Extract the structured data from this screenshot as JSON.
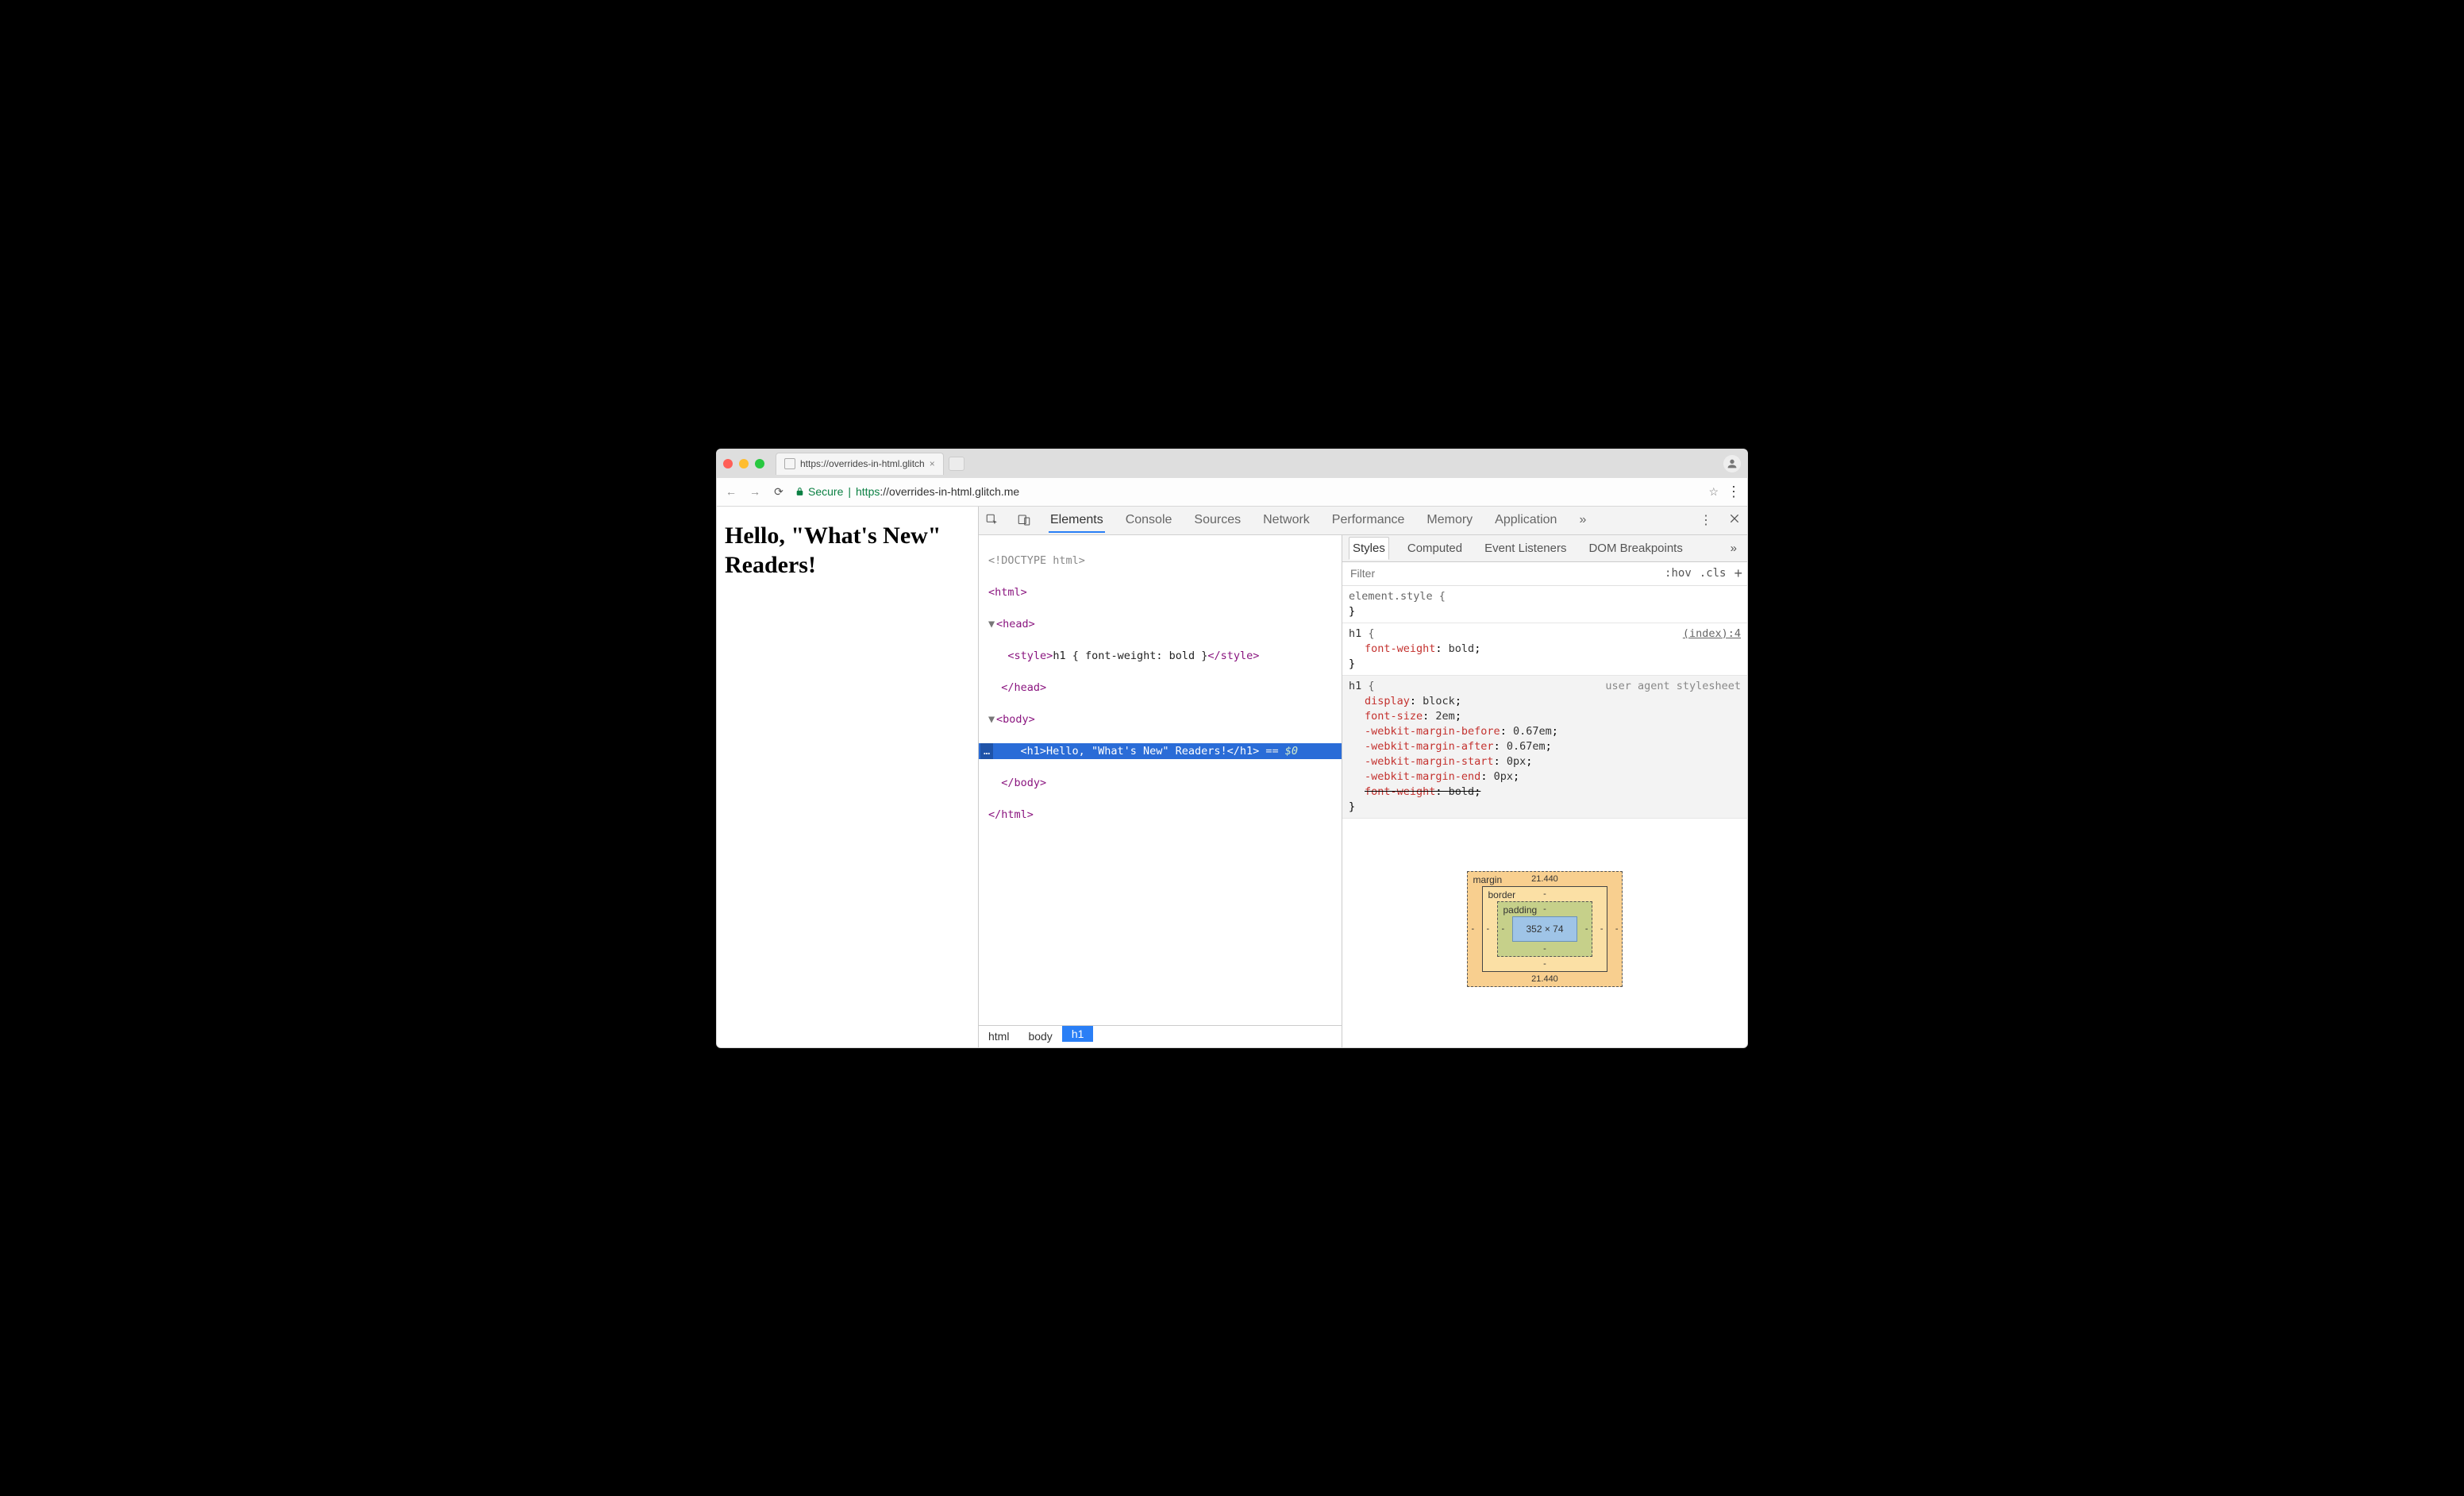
{
  "tab": {
    "title": "https://overrides-in-html.glitch"
  },
  "omnibox": {
    "secure_label": "Secure",
    "proto": "https",
    "url_rest": "://overrides-in-html.glitch.me"
  },
  "page": {
    "h1": "Hello, \"What's New\" Readers!"
  },
  "devtools": {
    "tabs": [
      "Elements",
      "Console",
      "Sources",
      "Network",
      "Performance",
      "Memory",
      "Application"
    ],
    "more": "»"
  },
  "dom": {
    "doctype": "<!DOCTYPE html>",
    "html_open": "<html>",
    "head_open": "<head>",
    "style_line_open": "<style>",
    "style_css": "h1 { font-weight: bold }",
    "style_line_close": "</style>",
    "head_close": "</head>",
    "body_open": "<body>",
    "selected": {
      "ellipsis": "…",
      "open": "<h1>",
      "text": "Hello, \"What's New\" Readers!",
      "close": "</h1>",
      "eq": " == ",
      "ref": "$0"
    },
    "body_close": "</body>",
    "html_close": "</html>"
  },
  "breadcrumb": [
    "html",
    "body",
    "h1"
  ],
  "styles_panel": {
    "tabs": [
      "Styles",
      "Computed",
      "Event Listeners",
      "DOM Breakpoints"
    ],
    "more": "»",
    "filter_placeholder": "Filter",
    "hov": ":hov",
    "cls": ".cls",
    "rules": [
      {
        "selector": "element.style",
        "src": "",
        "decls": []
      },
      {
        "selector": "h1",
        "src": "(index):4",
        "src_link": true,
        "decls": [
          {
            "prop": "font-weight",
            "val": "bold",
            "ovr": false
          }
        ]
      },
      {
        "selector": "h1",
        "src": "user agent stylesheet",
        "ua": true,
        "decls": [
          {
            "prop": "display",
            "val": "block",
            "ovr": false
          },
          {
            "prop": "font-size",
            "val": "2em",
            "ovr": false
          },
          {
            "prop": "-webkit-margin-before",
            "val": "0.67em",
            "ovr": false
          },
          {
            "prop": "-webkit-margin-after",
            "val": "0.67em",
            "ovr": false
          },
          {
            "prop": "-webkit-margin-start",
            "val": "0px",
            "ovr": false
          },
          {
            "prop": "-webkit-margin-end",
            "val": "0px",
            "ovr": false
          },
          {
            "prop": "font-weight",
            "val": "bold",
            "ovr": true
          }
        ]
      }
    ]
  },
  "boxmodel": {
    "margin": {
      "label": "margin",
      "top": "21.440",
      "right": "-",
      "bottom": "21.440",
      "left": "-"
    },
    "border": {
      "label": "border",
      "top": "-",
      "right": "-",
      "bottom": "-",
      "left": "-"
    },
    "padding": {
      "label": "padding",
      "top": "-",
      "right": "-",
      "bottom": "-",
      "left": "-"
    },
    "content": "352 × 74"
  }
}
